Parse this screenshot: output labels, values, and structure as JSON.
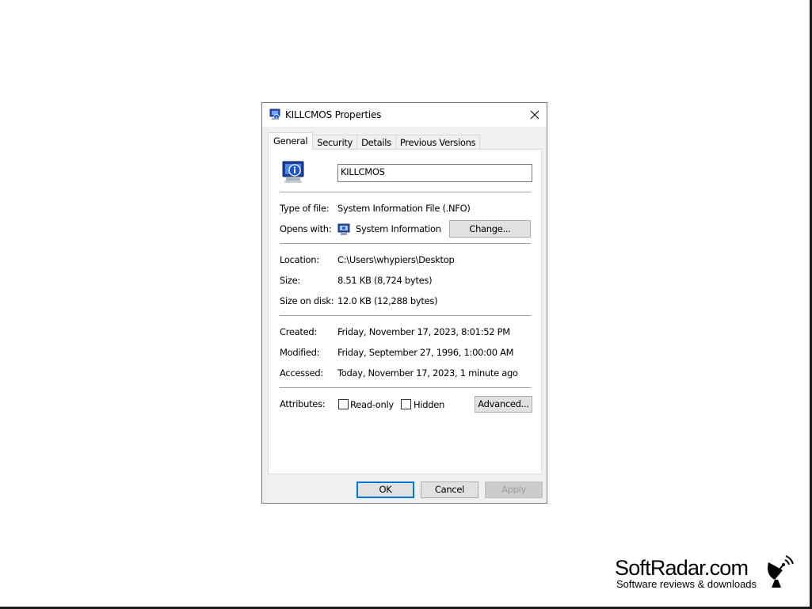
{
  "window": {
    "title": "KILLCMOS Properties",
    "icon": "system-info-file-icon"
  },
  "tabs": [
    {
      "label": "General",
      "active": true
    },
    {
      "label": "Security",
      "active": false
    },
    {
      "label": "Details",
      "active": false
    },
    {
      "label": "Previous Versions",
      "active": false
    }
  ],
  "general": {
    "file_name": "KILLCMOS",
    "type_label": "Type of file:",
    "type_value": "System Information File (.NFO)",
    "opens_label": "Opens with:",
    "opens_value": "System Information",
    "change_button": "Change...",
    "location_label": "Location:",
    "location_value": "C:\\Users\\whypiers\\Desktop",
    "size_label": "Size:",
    "size_value": "8.51 KB (8,724 bytes)",
    "size_on_disk_label": "Size on disk:",
    "size_on_disk_value": "12.0 KB (12,288 bytes)",
    "created_label": "Created:",
    "created_value": "Friday, November 17, 2023, 8:01:52 PM",
    "modified_label": "Modified:",
    "modified_value": "Friday, September 27, 1996, 1:00:00 AM",
    "accessed_label": "Accessed:",
    "accessed_value": "Today, November 17, 2023, 1 minute ago",
    "attributes_label": "Attributes:",
    "readonly_label": "Read-only",
    "readonly_checked": false,
    "hidden_label": "Hidden",
    "hidden_checked": false,
    "advanced_button": "Advanced..."
  },
  "footer": {
    "ok": "OK",
    "cancel": "Cancel",
    "apply": "Apply"
  },
  "watermark": {
    "title": "SoftRadar.com",
    "subtitle": "Software reviews & downloads"
  },
  "colors": {
    "focus_border": "#0078d7",
    "dialog_bg": "#f0f0f0",
    "disabled_text": "#a0a0a0"
  }
}
